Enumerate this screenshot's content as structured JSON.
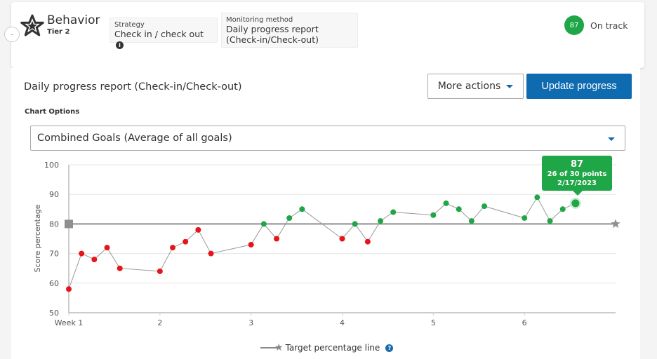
{
  "header": {
    "title": "Behavior",
    "tier": "Tier 2",
    "collapse_symbol": "–",
    "strategy_label": "Strategy",
    "strategy_value": "Check in / check out",
    "info_symbol": "i",
    "method_label": "Monitoring method",
    "method_value_line1": "Daily progress report",
    "method_value_line2": "(Check-in/Check-out)",
    "score": "87",
    "status": "On track"
  },
  "main": {
    "report_title": "Daily progress report (Check-in/Check-out)",
    "more_actions_label": "More actions",
    "update_progress_label": "Update progress",
    "chart_options_label": "Chart Options",
    "goal_select_value": "Combined Goals (Average of all goals)"
  },
  "tooltip": {
    "score": "87",
    "points": "26 of 30 points",
    "date": "2/17/2023"
  },
  "legend": {
    "label": "Target percentage line",
    "help_symbol": "?"
  },
  "colors": {
    "on_track": "#1fa646",
    "below_target": "#e8141b",
    "primary": "#0f6bb0",
    "target_line": "#8f8f8f"
  },
  "chart_data": {
    "type": "line",
    "title": "",
    "xlabel": "",
    "ylabel": "Score percentage",
    "ylim": [
      50,
      100
    ],
    "yticks": [
      50,
      60,
      70,
      80,
      90,
      100
    ],
    "xlim": [
      1,
      7
    ],
    "xticks": [
      {
        "value": 1,
        "label": "Week 1"
      },
      {
        "value": 2,
        "label": "2"
      },
      {
        "value": 3,
        "label": "3"
      },
      {
        "value": 4,
        "label": "4"
      },
      {
        "value": 5,
        "label": "5"
      },
      {
        "value": 6,
        "label": "6"
      }
    ],
    "grid": true,
    "legend_position": "bottom-center",
    "target": 80,
    "series": [
      {
        "name": "Combined Goals",
        "x": [
          1.0,
          1.14,
          1.28,
          1.42,
          1.56,
          2.0,
          2.14,
          2.28,
          2.42,
          2.56,
          3.0,
          3.14,
          3.28,
          3.42,
          3.56,
          4.0,
          4.14,
          4.28,
          4.42,
          4.56,
          5.0,
          5.14,
          5.28,
          5.42,
          5.56,
          6.0,
          6.14,
          6.28,
          6.42,
          6.56
        ],
        "values": [
          58,
          70,
          68,
          72,
          65,
          64,
          72,
          74,
          78,
          70,
          73,
          80,
          75,
          82,
          85,
          75,
          80,
          74,
          81,
          84,
          83,
          87,
          85,
          81,
          86,
          82,
          89,
          81,
          85,
          87
        ]
      }
    ],
    "highlighted_point": {
      "index": 29,
      "value": 87,
      "points": "26 of 30 points",
      "date": "2/17/2023"
    }
  }
}
